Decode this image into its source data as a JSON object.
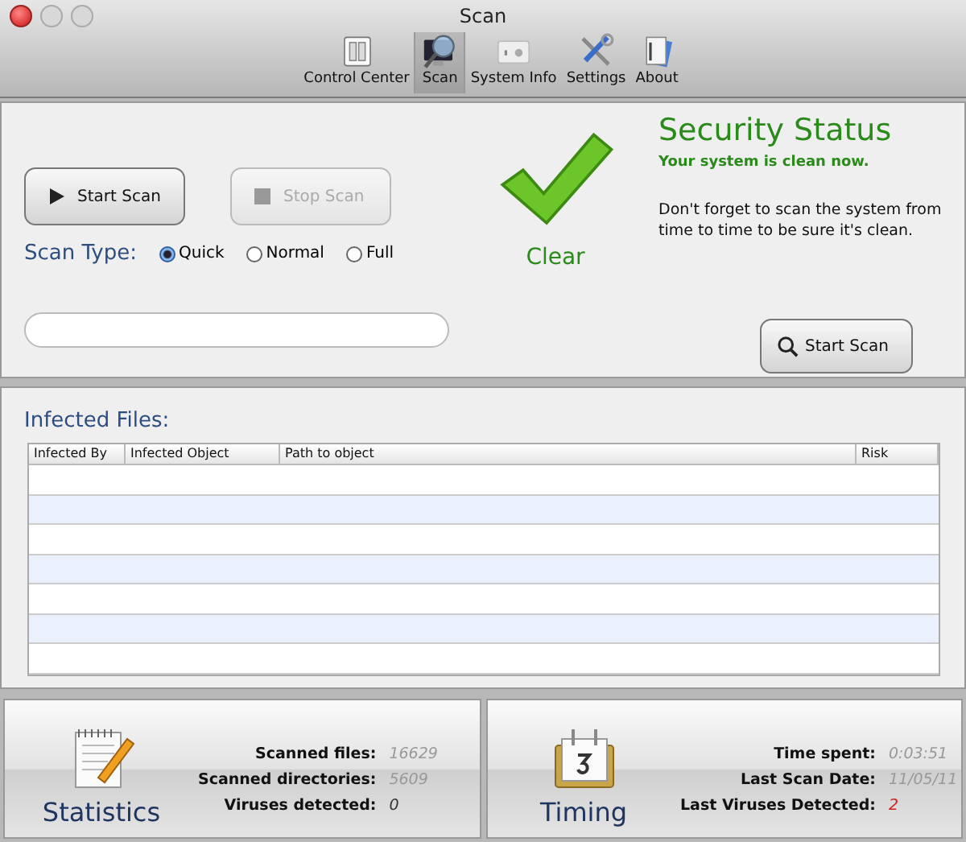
{
  "window": {
    "title": "Scan"
  },
  "toolbar": [
    {
      "label": "Control Center",
      "selected": false
    },
    {
      "label": "Scan",
      "selected": true
    },
    {
      "label": "System Info",
      "selected": false
    },
    {
      "label": "Settings",
      "selected": false
    },
    {
      "label": "About",
      "selected": false
    }
  ],
  "scan_controls": {
    "start_button": {
      "label": "Start Scan",
      "disabled": false
    },
    "stop_button": {
      "label": "Stop Scan",
      "disabled": true
    },
    "scan_type_label": "Scan Type:",
    "scan_types": [
      {
        "label": "Quick",
        "selected": true
      },
      {
        "label": "Normal",
        "selected": false
      },
      {
        "label": "Full",
        "selected": false
      }
    ],
    "progress": {
      "level": 0
    }
  },
  "status": {
    "badge": "Clear",
    "title": "Security Status",
    "headline": "Your system is clean now.",
    "message": "Don't forget to scan the system from time to time to be sure it's clean.",
    "scan_button": "Start Scan"
  },
  "infected_files": {
    "title": "Infected Files:",
    "columns": [
      "Infected By",
      "Infected Object",
      "Path to object",
      "Risk"
    ]
  },
  "statistics": {
    "title": "Statistics",
    "rows": [
      {
        "label": "Scanned files:",
        "value": "16629",
        "color": "#999999"
      },
      {
        "label": "Scanned directories:",
        "value": "5609",
        "color": "#999999"
      },
      {
        "label": "Viruses detected:",
        "value": "0",
        "color": "#333333"
      }
    ]
  },
  "timing": {
    "title": "Timing",
    "rows": [
      {
        "label": "Time spent:",
        "value": "0:03:51",
        "color": "#999999"
      },
      {
        "label": "Last Scan Date:",
        "value": "11/05/11",
        "color": "#999999"
      },
      {
        "label": "Last Viruses Detected:",
        "value": "2",
        "color": "#d42020"
      }
    ]
  }
}
